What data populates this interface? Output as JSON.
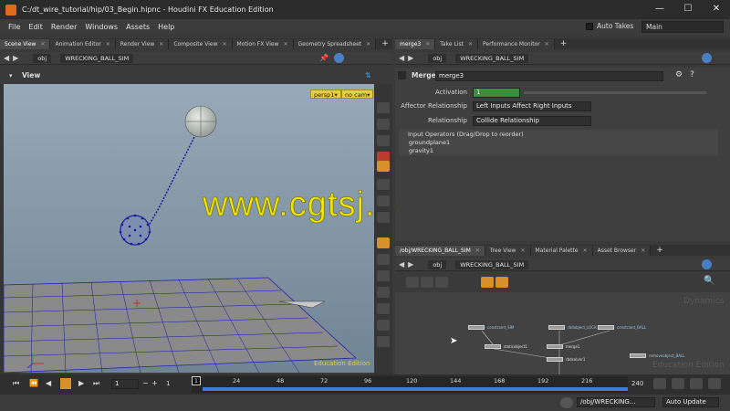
{
  "window": {
    "title": "C:/dt_wire_tutorial/hip/03_Begin.hipnc - Houdini FX Education Edition",
    "minimize": "—",
    "maximize": "☐",
    "close": "✕"
  },
  "menu": {
    "items": [
      "File",
      "Edit",
      "Render",
      "Windows",
      "Assets",
      "Help"
    ],
    "auto_takes": "Auto Takes",
    "desktop": "Main"
  },
  "left_tabs": [
    "Scene View",
    "Animation Editor",
    "Render View",
    "Composite View",
    "Motion FX View",
    "Geometry Spreadsheet"
  ],
  "left_path": {
    "context": "obj",
    "node": "WRECKING_BALL_SIM"
  },
  "viewport": {
    "label": "View",
    "camera": "persp1",
    "cam_mode": "no cam",
    "watermark": "Education Edition",
    "overlay_text": "www.cgtsj.com"
  },
  "right_tabs": [
    "merge3",
    "Take List",
    "Performance Monitor"
  ],
  "right_path": {
    "context": "obj",
    "node": "WRECKING_BALL_SIM"
  },
  "params": {
    "node_type": "Merge",
    "node_name": "merge3",
    "activation_label": "Activation",
    "activation_value": "1",
    "affector_label": "Affector Relationship",
    "affector_value": "Left Inputs Affect Right Inputs",
    "relationship_label": "Relationship",
    "relationship_value": "Collide Relationship",
    "input_header": "Input Operators (Drag/Drop to reorder)",
    "inputs": [
      "groundplane1",
      "gravity1"
    ]
  },
  "network_tabs": [
    "/obj/WRECKING_BALL_SIM",
    "Tree View",
    "Material Palette",
    "Asset Browser"
  ],
  "network_path": {
    "context": "obj",
    "node": "WRECKING_BALL_SIM"
  },
  "network": {
    "dynamics_label": "Dynamics",
    "watermark": "Education Edition",
    "nodes": [
      "constraint_SIM",
      "rbdobject_LOCK",
      "constraint_BALL",
      "staticobject1",
      "merge1",
      "rbdsolver1",
      "removeobject_BALL"
    ]
  },
  "timeline": {
    "start_frame": "1",
    "current_frame": "1",
    "range_start": "1",
    "end_frame": "240",
    "ticks": [
      "24",
      "48",
      "72",
      "96",
      "120",
      "144",
      "168",
      "192",
      "216"
    ],
    "playhead": "1"
  },
  "status": {
    "path": "/obj/WRECKING...",
    "update_mode": "Auto Update"
  },
  "colors": {
    "orange": "#d7902a",
    "activation_green": "#3a8d3a",
    "timeline_blue": "#3a7fd6",
    "overlay_yellow": "#f2e600"
  }
}
